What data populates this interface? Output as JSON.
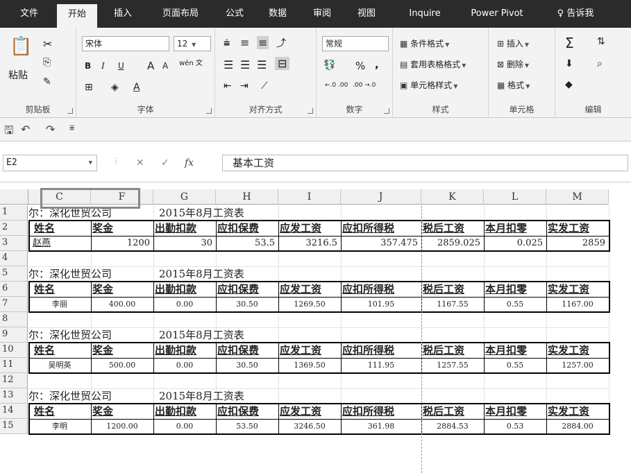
{
  "tabs": [
    "文件",
    "开始",
    "插入",
    "页面布局",
    "公式",
    "数据",
    "审阅",
    "视图",
    "Inquire",
    "Power Pivot",
    "♀ 告诉我"
  ],
  "ribbon": {
    "clipboard": {
      "paste": "粘贴",
      "label": "剪贴板"
    },
    "font": {
      "name": "宋体",
      "size": "12",
      "label": "字体",
      "bold": "B",
      "italic": "I",
      "underline": "U",
      "grow": "A",
      "shrink": "A",
      "color": "A",
      "phonetic": "wén 文"
    },
    "align": {
      "label": "对齐方式"
    },
    "number": {
      "format": "常规",
      "percent": "%",
      "comma": ",",
      "label": "数字",
      "inc": "←.0 .00",
      "dec": ".00 →.0"
    },
    "styles": {
      "cond": "条件格式",
      "table": "套用表格格式",
      "cell": "单元格样式",
      "label": "样式"
    },
    "cells": {
      "insert": "插入",
      "delete": "删除",
      "format": "格式",
      "label": "单元格"
    },
    "editing": {
      "label": "编辑"
    }
  },
  "formula_bar": {
    "name_box": "E2",
    "formula": "基本工资",
    "fx": "fx"
  },
  "columns": [
    "C",
    "F",
    "G",
    "H",
    "I",
    "J",
    "K",
    "L",
    "M"
  ],
  "rows": [
    "1",
    "2",
    "3",
    "4",
    "5",
    "6",
    "7",
    "8",
    "9",
    "10",
    "11",
    "12",
    "13",
    "14",
    "15"
  ],
  "title_left": "尔：深化世贸公司",
  "title_right": "2015年8月工资表",
  "headers": [
    "姓名",
    "奖金",
    "出勤扣款",
    "应扣保费",
    "应发工资",
    "应扣所得税",
    "税后工资",
    "本月扣零",
    "实发工资"
  ],
  "records": [
    [
      "赵燕",
      "1200",
      "30",
      "53.5",
      "3216.5",
      "357.475",
      "2859.025",
      "0.025",
      "2859"
    ],
    [
      "李丽",
      "400.00",
      "0.00",
      "30.50",
      "1269.50",
      "101.95",
      "1167.55",
      "0.55",
      "1167.00"
    ],
    [
      "吴明英",
      "500.00",
      "0.00",
      "30.50",
      "1369.50",
      "111.95",
      "1257.55",
      "0.55",
      "1257.00"
    ],
    [
      "李明",
      "1200.00",
      "0.00",
      "53.50",
      "3246.50",
      "361.98",
      "2884.53",
      "0.53",
      "2884.00"
    ]
  ]
}
